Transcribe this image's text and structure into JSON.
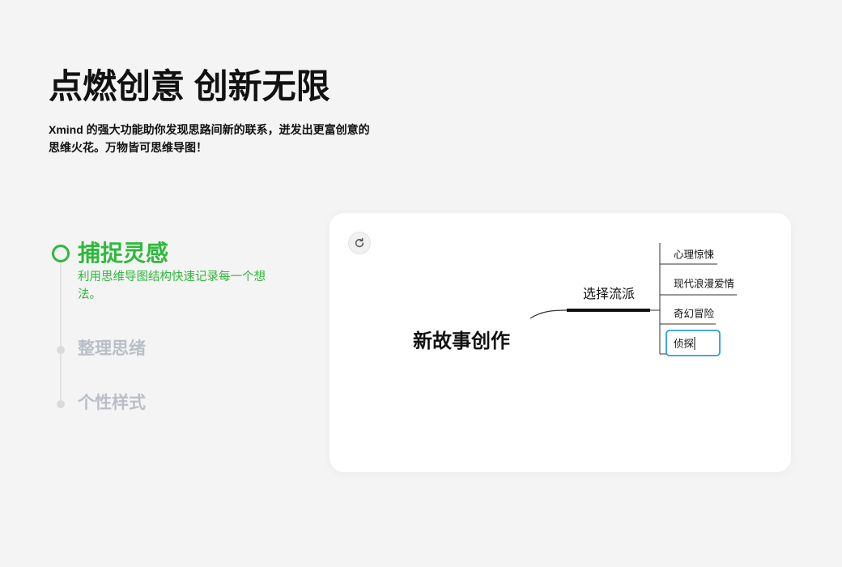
{
  "hero": {
    "title": "点燃创意 创新无限",
    "subtitle": "Xmind 的强大功能助你发现思路间新的联系，迸发出更富创意的思维火花。万物皆可思维导图！"
  },
  "steps": [
    {
      "label": "捕捉灵感",
      "description": "利用思维导图结构快速记录每一个想法。",
      "active": true
    },
    {
      "label": "整理思绪",
      "active": false
    },
    {
      "label": "个性样式",
      "active": false
    }
  ],
  "demo": {
    "replay_icon": "refresh-icon"
  },
  "mindmap": {
    "central_topic": "新故事创作",
    "main_branch": "选择流派",
    "subtopics": [
      "心理惊悚",
      "现代浪漫爱情",
      "奇幻冒险",
      "侦探"
    ],
    "editing_subtopic_index": 3
  },
  "theme": {
    "accent": "#2fb93c",
    "inactive": "#b9bfc7",
    "edit_blue": "#2d9cdb",
    "background": "#f4f4f4"
  }
}
